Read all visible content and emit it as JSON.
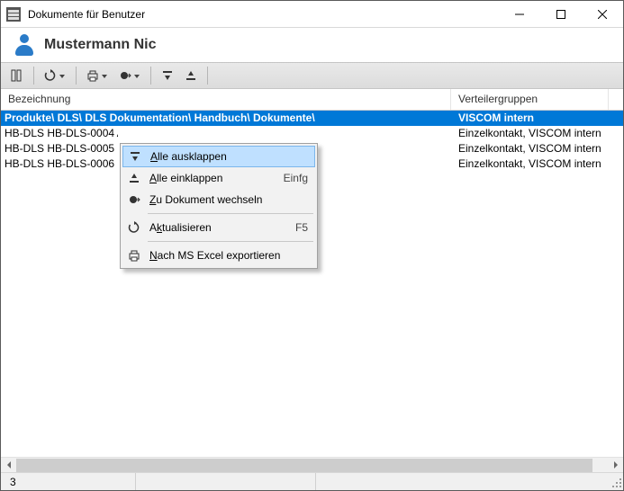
{
  "window": {
    "title": "Dokumente für Benutzer"
  },
  "user": {
    "name": "Mustermann Nic"
  },
  "columns": {
    "c1": "Bezeichnung",
    "c2": "Verteilergruppen",
    "c1_width": 500,
    "c2_width": 175
  },
  "rows": [
    {
      "c1": "Produkte\\ DLS\\ DLS Dokumentation\\ Handbuch\\ Dokumente\\",
      "c2": "VISCOM intern",
      "selected": true
    },
    {
      "c1": "HB-DLS HB-DLS-0004 Au",
      "c2": "Einzelkontakt, VISCOM intern",
      "selected": false
    },
    {
      "c1": "HB-DLS HB-DLS-0005 Do",
      "c2": "Einzelkontakt, VISCOM intern",
      "selected": false
    },
    {
      "c1": "HB-DLS HB-DLS-0006 Do",
      "c2": "Einzelkontakt, VISCOM intern",
      "selected": false
    }
  ],
  "context_menu": {
    "items": [
      {
        "icon": "expand-icon",
        "label": "Alle ausklappen",
        "accel": "",
        "hot": "A",
        "hl": true
      },
      {
        "icon": "collapse-icon",
        "label": "Alle einklappen",
        "accel": "Einfg",
        "hot": "A",
        "hl": false
      },
      {
        "icon": "goto-icon",
        "label": "Zu Dokument wechseln",
        "accel": "",
        "hot": "Z",
        "hl": false
      },
      {
        "sep": true
      },
      {
        "icon": "refresh-icon",
        "label": "Aktualisieren",
        "accel": "F5",
        "hot": "k",
        "hl": false
      },
      {
        "sep": true
      },
      {
        "icon": "excel-icon",
        "label": "Nach MS Excel exportieren",
        "accel": "",
        "hot": "N",
        "hl": false
      }
    ]
  },
  "status": {
    "count": "3"
  },
  "toolbar_icons": [
    "columns-icon",
    "refresh-icon",
    "print-icon",
    "goto-icon",
    "expand-icon",
    "collapse-icon"
  ]
}
